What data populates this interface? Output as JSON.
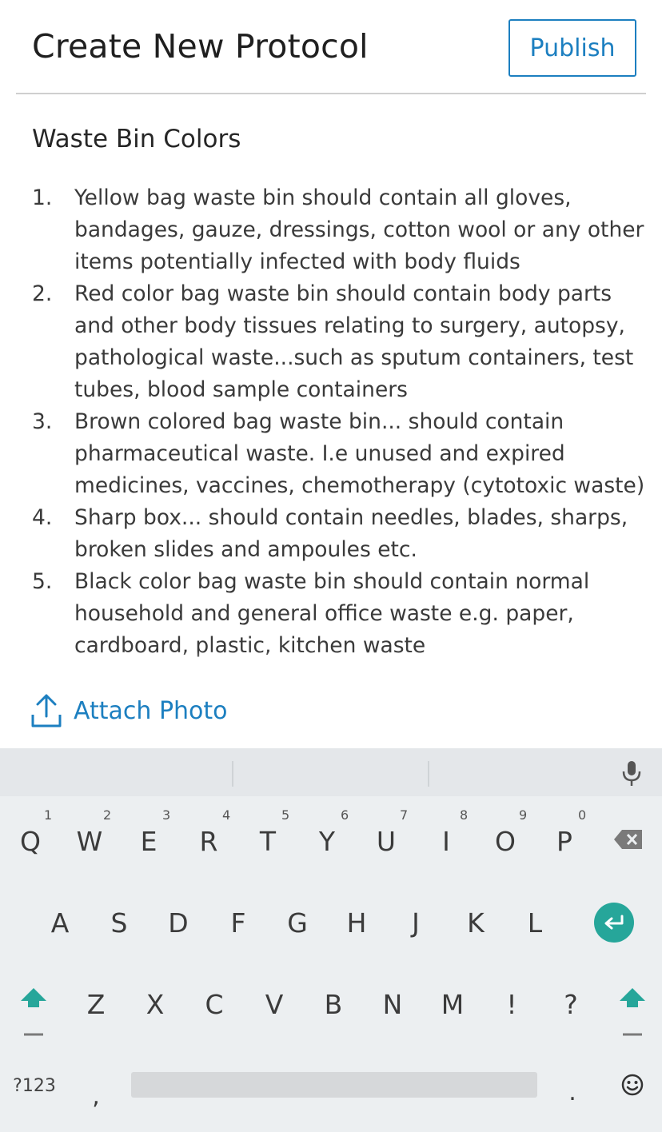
{
  "header": {
    "title": "Create New Protocol",
    "publish_label": "Publish"
  },
  "protocol": {
    "title": "Waste Bin Colors",
    "items": [
      {
        "num": "1.",
        "text": "Yellow bag waste bin should contain all gloves, bandages, gauze, dressings, cotton wool or any other items potentially infected with body fluids"
      },
      {
        "num": "2.",
        "text": "Red color bag waste bin should contain body parts and other body tissues relating to surgery, autopsy, pathological waste...such as sputum containers, test tubes, blood sample containers"
      },
      {
        "num": "3.",
        "text": "Brown colored bag waste bin... should contain pharmaceutical waste. I.e unused and expired medicines, vaccines, chemotherapy (cytotoxic waste)"
      },
      {
        "num": "4.",
        "text": "Sharp box... should contain needles, blades, sharps, broken slides and ampoules etc."
      },
      {
        "num": "5.",
        "text": "Black color bag waste bin should contain normal household and general office waste e.g. paper, cardboard, plastic, kitchen waste"
      }
    ]
  },
  "attach": {
    "label": "Attach Photo",
    "icon": "upload-icon"
  },
  "keyboard": {
    "row1": [
      "Q",
      "W",
      "E",
      "R",
      "T",
      "Y",
      "U",
      "I",
      "O",
      "P"
    ],
    "row1_hints": [
      "1",
      "2",
      "3",
      "4",
      "5",
      "6",
      "7",
      "8",
      "9",
      "0"
    ],
    "row2": [
      "A",
      "S",
      "D",
      "F",
      "G",
      "H",
      "J",
      "K",
      "L"
    ],
    "row3": [
      "Z",
      "X",
      "C",
      "V",
      "B",
      "N",
      "M",
      "!",
      "?"
    ],
    "symbols_label": "?123",
    "comma": ",",
    "period": "."
  },
  "colors": {
    "accent": "#1c7fc0",
    "enter": "#26a69a",
    "keyboard_bg": "#eceff1"
  }
}
